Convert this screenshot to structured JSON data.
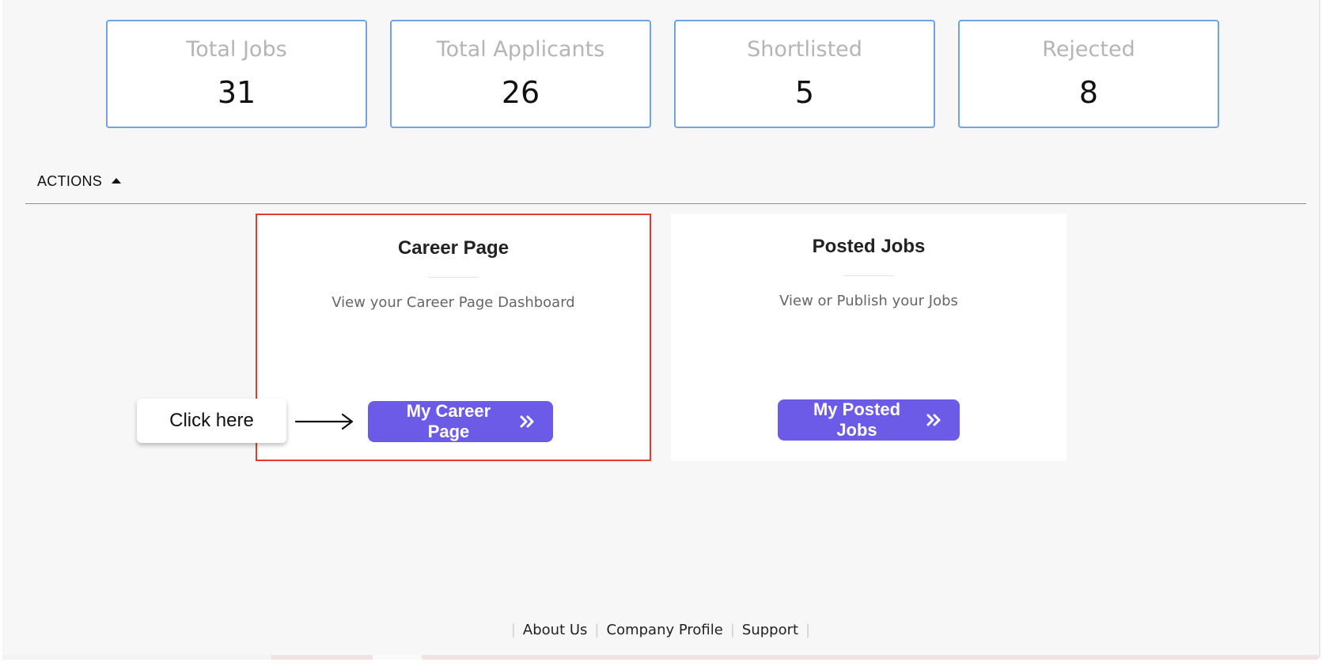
{
  "stats": [
    {
      "label": "Total Jobs",
      "value": "31"
    },
    {
      "label": "Total Applicants",
      "value": "26"
    },
    {
      "label": "Shortlisted",
      "value": "5"
    },
    {
      "label": "Rejected",
      "value": "8"
    }
  ],
  "actions": {
    "header_label": "ACTIONS",
    "header_icon": "caret-up-icon"
  },
  "cards": [
    {
      "title": "Career Page",
      "description": "View your Career Page Dashboard",
      "button_label": "My Career Page",
      "button_icon": "double-chevron-right-icon",
      "highlighted": true
    },
    {
      "title": "Posted Jobs",
      "description": "View or Publish your Jobs",
      "button_label": "My Posted Jobs",
      "button_icon": "double-chevron-right-icon",
      "highlighted": false
    }
  ],
  "callout": {
    "text": "Click here"
  },
  "footer": {
    "links": [
      "About Us",
      "Company Profile",
      "Support"
    ]
  },
  "colors": {
    "accent": "#6b5be6",
    "card_border": "#6fa3e3",
    "highlight_border": "#e23b30",
    "background": "#f7f7f7"
  }
}
